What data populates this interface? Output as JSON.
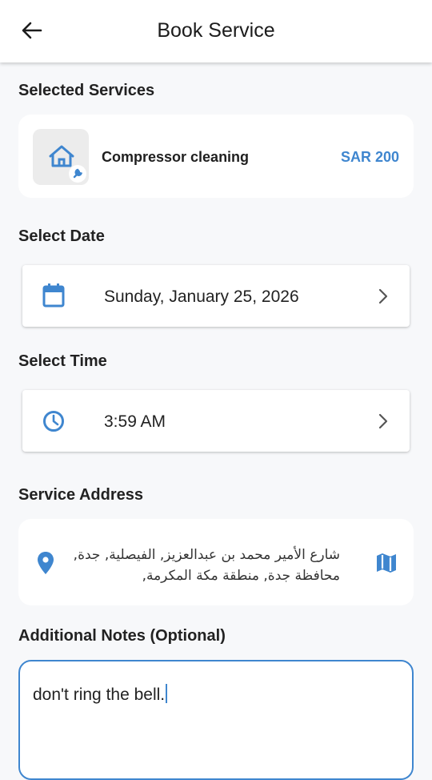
{
  "header": {
    "title": "Book Service",
    "back_icon": "arrow-left-icon"
  },
  "selected_services": {
    "title": "Selected Services",
    "items": [
      {
        "name": "Compressor cleaning",
        "price": "SAR 200",
        "icon": "home-repair-icon"
      }
    ]
  },
  "date": {
    "title": "Select Date",
    "value": "Sunday, January 25, 2026",
    "icon": "calendar-icon"
  },
  "time": {
    "title": "Select Time",
    "value": "3:59 AM",
    "icon": "clock-icon"
  },
  "address": {
    "title": "Service Address",
    "value": "شارع الأمير محمد بن عبدالعزيز, الفيصلية, جدة, محافظة جدة, منطقة مكة المكرمة,",
    "icons": [
      "location-pin-icon",
      "map-icon"
    ]
  },
  "notes": {
    "title": "Additional Notes (Optional)",
    "value": "don't ring the bell."
  },
  "colors": {
    "accent": "#3f86cf",
    "background": "#f7f8fa",
    "card": "#ffffff"
  }
}
